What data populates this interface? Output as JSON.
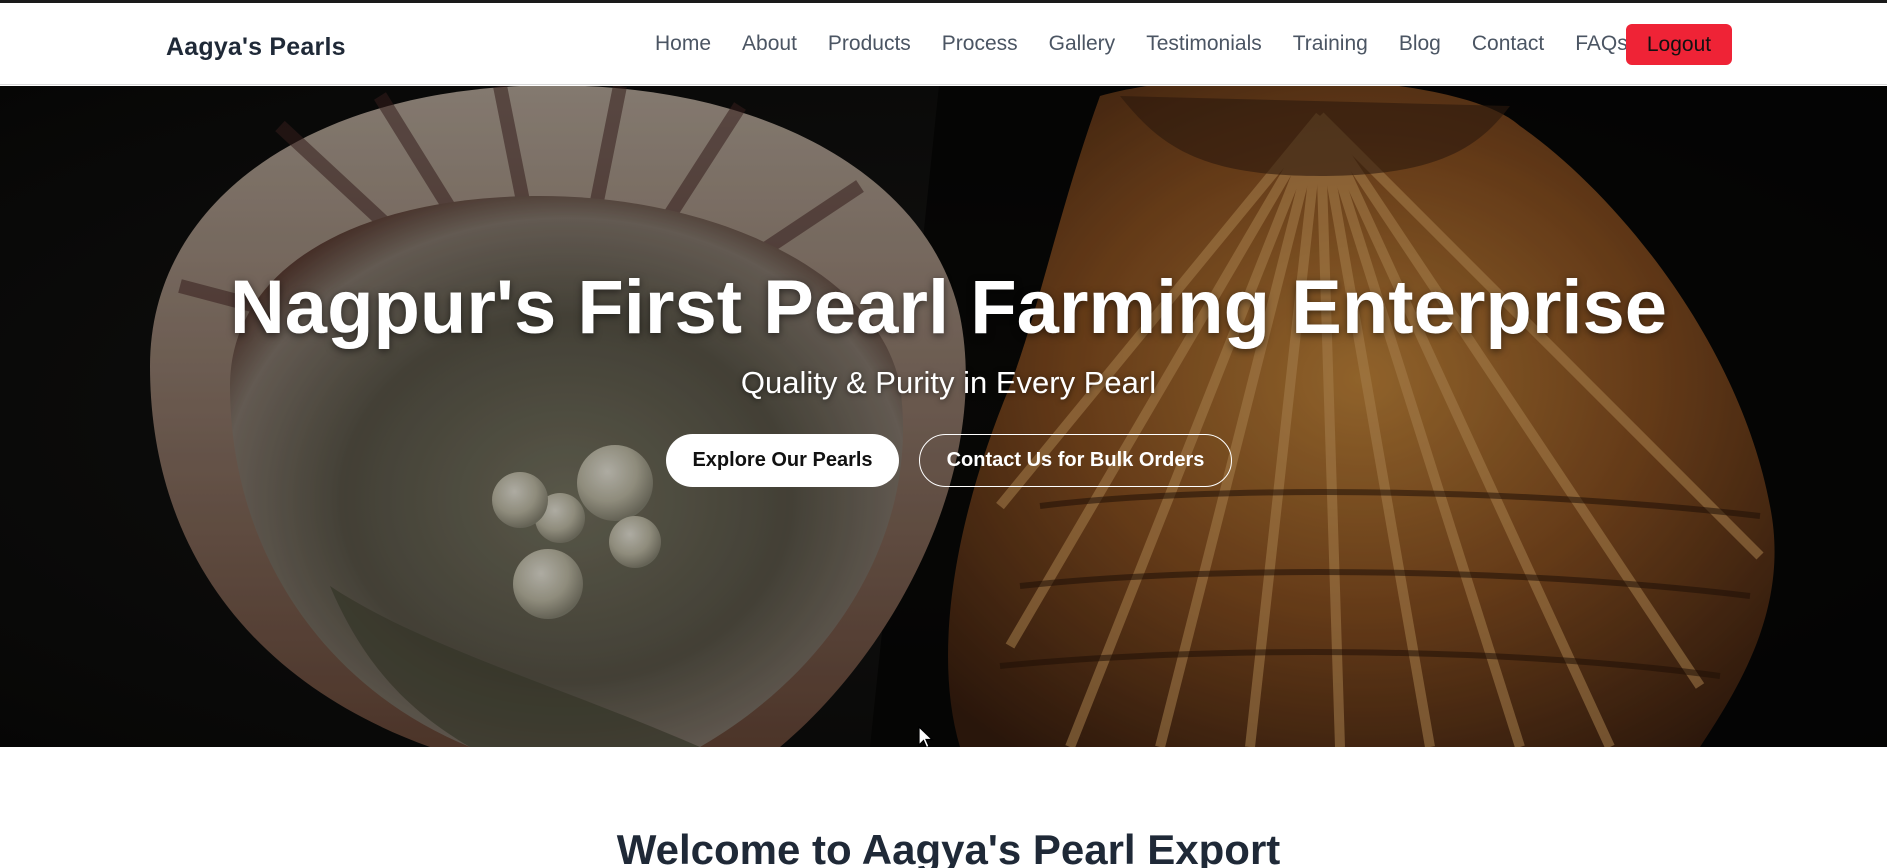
{
  "brand": {
    "name": "Aagya's Pearls"
  },
  "nav": {
    "items": [
      {
        "label": "Home"
      },
      {
        "label": "About"
      },
      {
        "label": "Products"
      },
      {
        "label": "Process"
      },
      {
        "label": "Gallery"
      },
      {
        "label": "Testimonials"
      },
      {
        "label": "Training"
      },
      {
        "label": "Blog"
      },
      {
        "label": "Contact"
      },
      {
        "label": "FAQs"
      }
    ],
    "logout_label": "Logout"
  },
  "hero": {
    "title": "Nagpur's First Pearl Farming Enterprise",
    "subtitle": "Quality & Purity in Every Pearl",
    "primary_button": "Explore Our Pearls",
    "secondary_button": "Contact Us for Bulk Orders",
    "background_image": "pearl-oyster-shells"
  },
  "welcome": {
    "heading": "Welcome to Aagya's Pearl Export"
  },
  "colors": {
    "logout": "#ef2336",
    "nav_text": "#4b5563",
    "heading_text": "#1f2937",
    "hero_text": "#ffffff"
  }
}
